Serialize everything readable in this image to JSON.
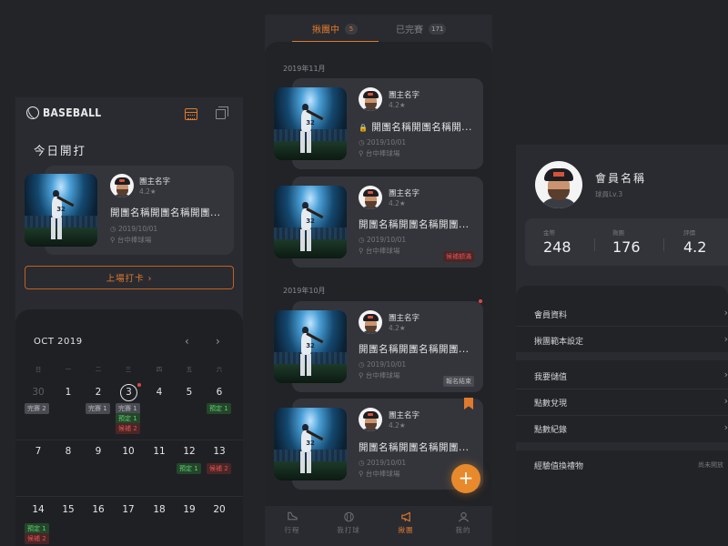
{
  "left": {
    "logo": "BASEBALL",
    "section_title": "今日開打",
    "card": {
      "host": "團主名字",
      "rating": "4.2★",
      "title": "開團名稱開團名稱開團...",
      "date": "2019/10/01",
      "venue": "台中棒球場"
    },
    "checkin_label": "上場打卡 ›",
    "calendar": {
      "month_label": "OCT 2019",
      "prev": "‹",
      "next": "›",
      "weekdays": [
        "日",
        "一",
        "二",
        "三",
        "四",
        "五",
        "六"
      ],
      "rows": [
        [
          "30",
          "1",
          "2",
          "3",
          "4",
          "5",
          "6"
        ],
        [
          "7",
          "8",
          "9",
          "10",
          "11",
          "12",
          "13"
        ],
        [
          "14",
          "15",
          "16",
          "17",
          "18",
          "19",
          "20"
        ]
      ],
      "tags": {
        "t30": "完賽 2",
        "t2": "完賽 1",
        "t3a": "完賽 1",
        "t3b": "預定 1",
        "t3c": "候補 2",
        "t6": "預定 1",
        "t12": "預定 1",
        "t13": "候補 2",
        "t14a": "預定 1",
        "t14b": "候補 2"
      }
    }
  },
  "mid": {
    "tabs": [
      {
        "label": "揪團中",
        "count": "5"
      },
      {
        "label": "已完賽",
        "count": "171"
      }
    ],
    "groups": [
      "2019年11月",
      "2019年10月"
    ],
    "cards": [
      {
        "host": "團主名字",
        "rating": "4.2★",
        "title": "開團名稱開團名稱開...",
        "date": "2019/10/01",
        "venue": "台中棒球場",
        "tag": ""
      },
      {
        "host": "團主名字",
        "rating": "4.2★",
        "title": "開團名稱開團名稱開團...",
        "date": "2019/10/01",
        "venue": "台中棒球場",
        "tag": "候補額滿"
      },
      {
        "host": "團主名字",
        "rating": "4.2★",
        "title": "開團名稱開團名稱開團...",
        "date": "2019/10/01",
        "venue": "台中棒球場",
        "tag": "報名結束"
      },
      {
        "host": "團主名字",
        "rating": "4.2★",
        "title": "開團名稱開團名稱開團...",
        "date": "2019/10/01",
        "venue": "台中棒球場",
        "tag": ""
      }
    ],
    "fab": "+",
    "bottom_nav": [
      "行程",
      "我打球",
      "揪團",
      "我的"
    ]
  },
  "right": {
    "member_name": "會員名稱",
    "member_level": "球員Lv.3",
    "stats": [
      {
        "label": "金幣",
        "value": "248"
      },
      {
        "label": "揪團",
        "value": "176"
      },
      {
        "label": "評價",
        "value": "4.2"
      }
    ],
    "menu": [
      "會員資料",
      "揪團範本設定",
      "我要儲值",
      "點數兌現",
      "點數紀錄",
      "經驗值換禮物"
    ],
    "menu_note": "尚未開放"
  },
  "colors": {
    "accent": "#e07a2e",
    "red": "#e04848",
    "green": "#5fcf6f",
    "bg": "#232428",
    "panel": "#2a2b30"
  }
}
